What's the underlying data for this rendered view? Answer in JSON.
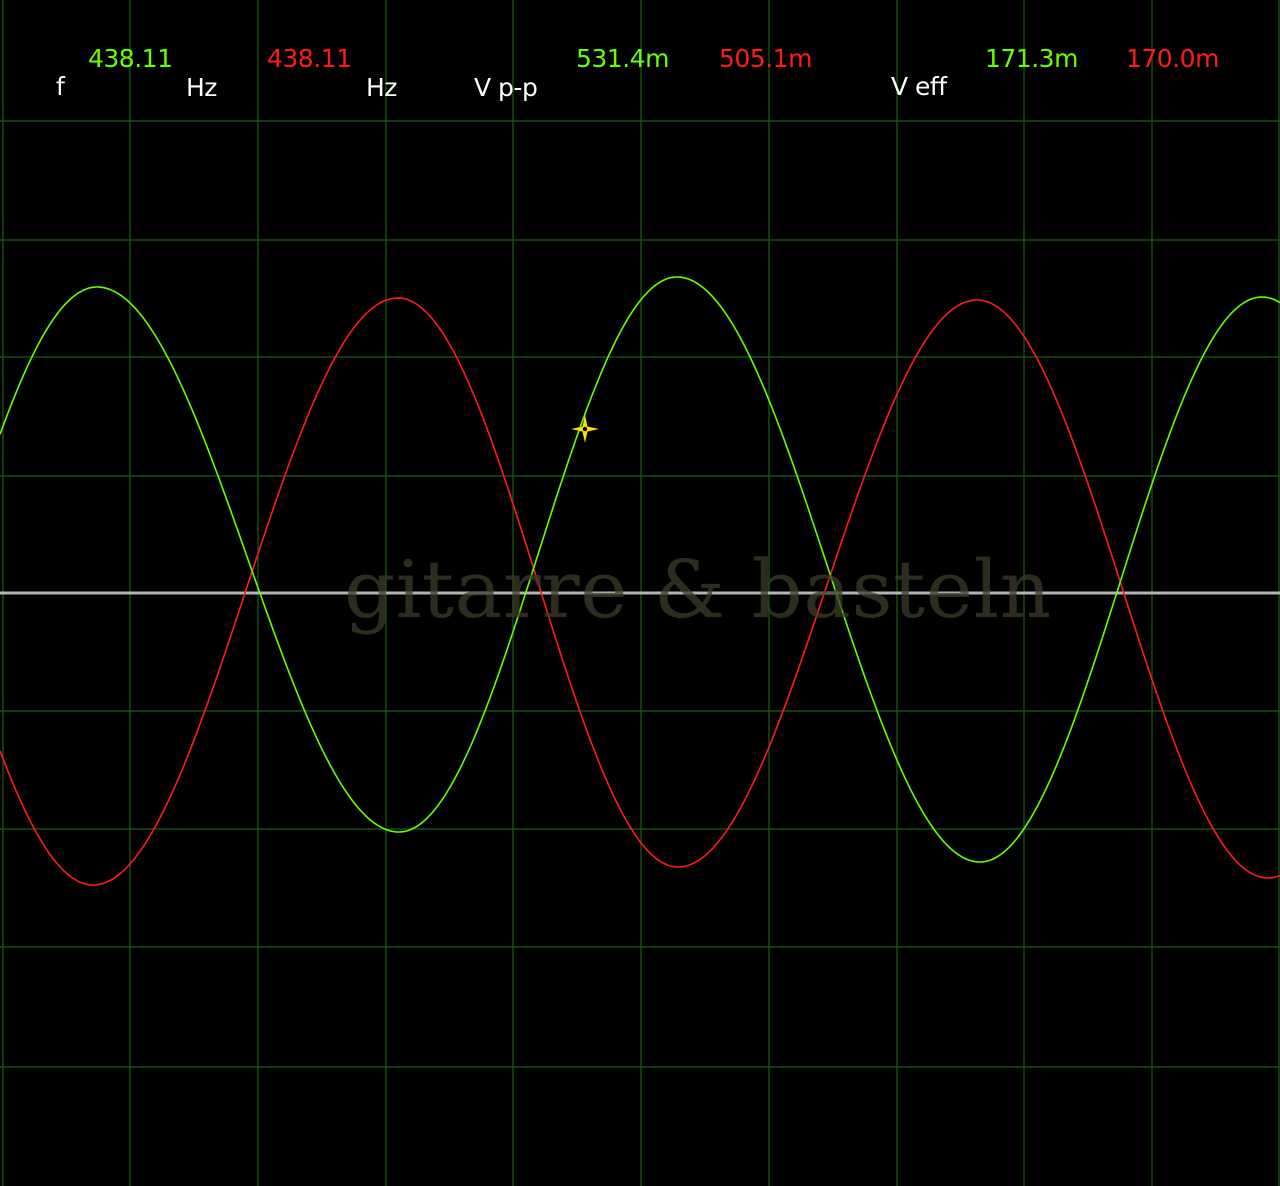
{
  "readouts": {
    "frequency": {
      "label": "f",
      "ch1_value": "438.11",
      "ch1_unit": "Hz",
      "ch2_value": "438.11",
      "ch2_unit": "Hz"
    },
    "vpp": {
      "label": "V p-p",
      "ch1_value": "531.4m",
      "ch2_value": "505.1m"
    },
    "veff": {
      "label": "V eff",
      "ch1_value": "171.3m",
      "ch2_value": "170.0m"
    }
  },
  "watermark": "gitarre & basteln",
  "cursor_icon": "four-point-star-crosshair-icon",
  "colors": {
    "background": "#000000",
    "grid": "#1d5c14",
    "baseline": "#b4b4b4",
    "channel1": "#66ff00",
    "channel2": "#ff1a1a",
    "label": "#ffffff",
    "cursor": "#ffe000"
  },
  "chart_data": {
    "type": "line",
    "grid": true,
    "x_divisions": 10,
    "y_divisions": 10,
    "series": [
      {
        "channel": 1,
        "color": "#66ff00",
        "frequency_hz": 438.11,
        "vpp": "531.4m",
        "veff": "171.3m",
        "phase": "leading"
      },
      {
        "channel": 2,
        "color": "#ff1a1a",
        "frequency_hz": 438.11,
        "vpp": "505.1m",
        "veff": "170.0m",
        "phase": "inverted (approx. 180°)"
      }
    ]
  }
}
